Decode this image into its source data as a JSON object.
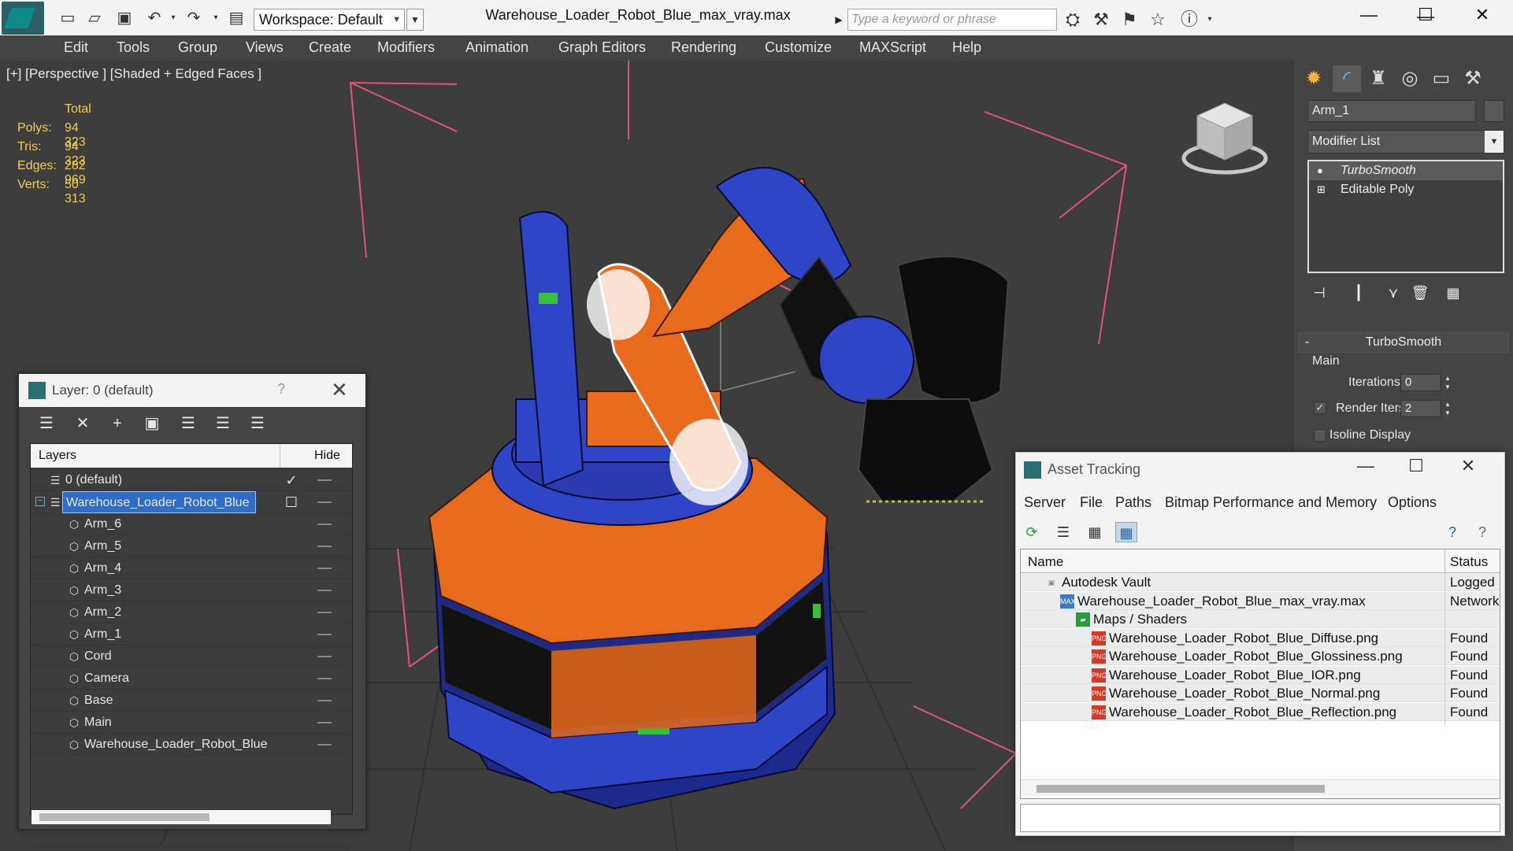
{
  "titlebar": {
    "workspace": "Workspace: Default",
    "window_title": "Warehouse_Loader_Robot_Blue_max_vray.max",
    "search_placeholder": "Type a keyword or phrase"
  },
  "menu": [
    "Edit",
    "Tools",
    "Group",
    "Views",
    "Create",
    "Modifiers",
    "Animation",
    "Graph Editors",
    "Rendering",
    "Customize",
    "MAXScript",
    "Help"
  ],
  "viewport": {
    "label": "[+] [Perspective ] [Shaded + Edged Faces ]",
    "stats": {
      "header": "Total",
      "rows": [
        {
          "label": "Polys:",
          "value": "94 323"
        },
        {
          "label": "Tris:",
          "value": "94 323"
        },
        {
          "label": "Edges:",
          "value": "282 969"
        },
        {
          "label": "Verts:",
          "value": "50 313"
        }
      ]
    }
  },
  "command_panel": {
    "object_name": "Arm_1",
    "modifier_list": "Modifier List",
    "stack": [
      "TurboSmooth",
      "Editable Poly"
    ],
    "rollout": {
      "title": "TurboSmooth",
      "group": "Main",
      "iterations_label": "Iterations:",
      "iterations_value": "0",
      "render_iters_label": "Render Iters:",
      "render_iters_value": "2",
      "isoline_label": "Isoline Display"
    }
  },
  "layer_dialog": {
    "title": "Layer: 0 (default)",
    "help": "?",
    "col_layers": "Layers",
    "col_hide": "Hide",
    "rows": [
      {
        "name": "0 (default)",
        "level": 0
      },
      {
        "name": "Warehouse_Loader_Robot_Blue",
        "level": 0
      },
      {
        "name": "Arm_6",
        "level": 1
      },
      {
        "name": "Arm_5",
        "level": 1
      },
      {
        "name": "Arm_4",
        "level": 1
      },
      {
        "name": "Arm_3",
        "level": 1
      },
      {
        "name": "Arm_2",
        "level": 1
      },
      {
        "name": "Arm_1",
        "level": 1
      },
      {
        "name": "Cord",
        "level": 1
      },
      {
        "name": "Camera",
        "level": 1
      },
      {
        "name": "Base",
        "level": 1
      },
      {
        "name": "Main",
        "level": 1
      },
      {
        "name": "Warehouse_Loader_Robot_Blue",
        "level": 1
      }
    ]
  },
  "asset_dialog": {
    "title": "Asset Tracking",
    "menu": [
      "Server",
      "File",
      "Paths",
      "Bitmap Performance and Memory",
      "Options"
    ],
    "col_name": "Name",
    "col_status": "Status",
    "rows": [
      {
        "name": "Autodesk Vault",
        "status": "Logged",
        "icon": "vault-icon"
      },
      {
        "name": "Warehouse_Loader_Robot_Blue_max_vray.max",
        "status": "Network",
        "icon": "max-file-icon"
      },
      {
        "name": "Maps / Shaders",
        "status": "",
        "icon": "maps-folder-icon"
      },
      {
        "name": "Warehouse_Loader_Robot_Blue_Diffuse.png",
        "status": "Found",
        "icon": "png-file-icon"
      },
      {
        "name": "Warehouse_Loader_Robot_Blue_Glossiness.png",
        "status": "Found",
        "icon": "png-file-icon"
      },
      {
        "name": "Warehouse_Loader_Robot_Blue_IOR.png",
        "status": "Found",
        "icon": "png-file-icon"
      },
      {
        "name": "Warehouse_Loader_Robot_Blue_Normal.png",
        "status": "Found",
        "icon": "png-file-icon"
      },
      {
        "name": "Warehouse_Loader_Robot_Blue_Reflection.png",
        "status": "Found",
        "icon": "png-file-icon"
      }
    ]
  },
  "colors": {
    "robot_blue": "#2f45c8",
    "robot_orange": "#e86b1d",
    "stats_yellow": "#f0d050",
    "selection_blue": "#2e6ec6"
  }
}
